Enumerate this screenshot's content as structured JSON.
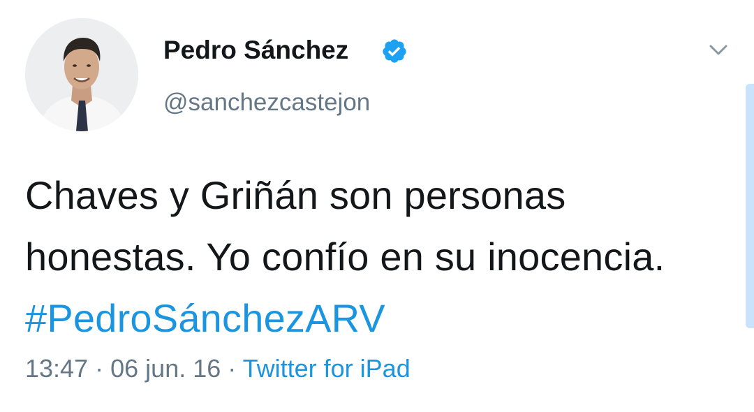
{
  "author": {
    "name": "Pedro Sánchez",
    "handle": "@sanchezcastejon",
    "verified": true
  },
  "tweet": {
    "text": "Chaves y Griñán son personas honestas. Yo confío en su inocencia.",
    "hashtag": "#PedroSánchezARV",
    "time": "13:47",
    "separator": "·",
    "date": "06 jun. 16",
    "source": "Twitter for iPad"
  },
  "icons": {
    "verified": "verified-badge-icon",
    "menu": "chevron-down-icon"
  },
  "colors": {
    "link": "#1b95e0",
    "secondary_text": "#657786",
    "primary_text": "#14171a",
    "scrollbar": "#c8e3fb"
  }
}
